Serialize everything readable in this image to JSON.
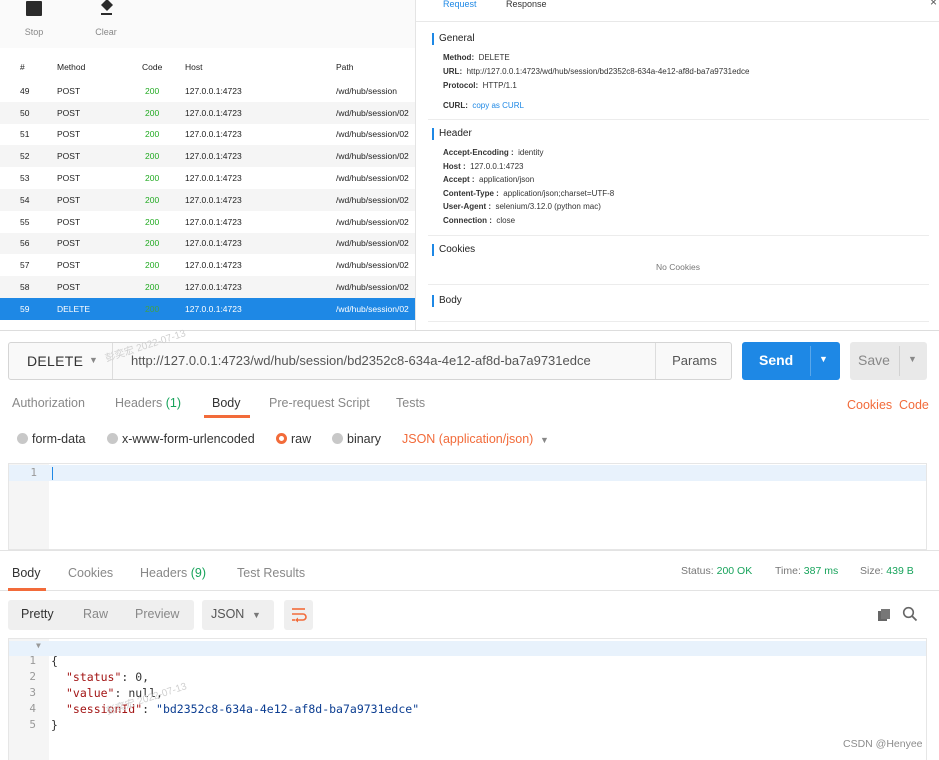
{
  "toolbar": {
    "stop_label": "Stop",
    "clear_label": "Clear"
  },
  "request_table": {
    "headers": {
      "num": "#",
      "method": "Method",
      "code": "Code",
      "host": "Host",
      "path": "Path"
    },
    "rows": [
      {
        "num": "49",
        "method": "POST",
        "code": "200",
        "host": "127.0.0.1:4723",
        "path": "/wd/hub/session"
      },
      {
        "num": "50",
        "method": "POST",
        "code": "200",
        "host": "127.0.0.1:4723",
        "path": "/wd/hub/session/02"
      },
      {
        "num": "51",
        "method": "POST",
        "code": "200",
        "host": "127.0.0.1:4723",
        "path": "/wd/hub/session/02"
      },
      {
        "num": "52",
        "method": "POST",
        "code": "200",
        "host": "127.0.0.1:4723",
        "path": "/wd/hub/session/02"
      },
      {
        "num": "53",
        "method": "POST",
        "code": "200",
        "host": "127.0.0.1:4723",
        "path": "/wd/hub/session/02"
      },
      {
        "num": "54",
        "method": "POST",
        "code": "200",
        "host": "127.0.0.1:4723",
        "path": "/wd/hub/session/02"
      },
      {
        "num": "55",
        "method": "POST",
        "code": "200",
        "host": "127.0.0.1:4723",
        "path": "/wd/hub/session/02"
      },
      {
        "num": "56",
        "method": "POST",
        "code": "200",
        "host": "127.0.0.1:4723",
        "path": "/wd/hub/session/02"
      },
      {
        "num": "57",
        "method": "POST",
        "code": "200",
        "host": "127.0.0.1:4723",
        "path": "/wd/hub/session/02"
      },
      {
        "num": "58",
        "method": "POST",
        "code": "200",
        "host": "127.0.0.1:4723",
        "path": "/wd/hub/session/02"
      },
      {
        "num": "59",
        "method": "DELETE",
        "code": "200",
        "host": "127.0.0.1:4723",
        "path": "/wd/hub/session/02",
        "selected": true
      }
    ]
  },
  "detail": {
    "tabs": {
      "request": "Request",
      "response": "Response"
    },
    "close": "×",
    "general": {
      "title": "General",
      "method_key": "Method:",
      "method_val": "DELETE",
      "url_key": "URL:",
      "url_val": "http://127.0.0.1:4723/wd/hub/session/bd2352c8-634a-4e12-af8d-ba7a9731edce",
      "protocol_key": "Protocol:",
      "protocol_val": "HTTP/1.1",
      "curl_key": "CURL:",
      "curl_val": "copy as CURL"
    },
    "header": {
      "title": "Header",
      "items": [
        {
          "key": "Accept-Encoding :",
          "val": "identity"
        },
        {
          "key": "Host :",
          "val": "127.0.0.1:4723"
        },
        {
          "key": "Accept :",
          "val": "application/json"
        },
        {
          "key": "Content-Type :",
          "val": "application/json;charset=UTF-8"
        },
        {
          "key": "User-Agent :",
          "val": "selenium/3.12.0 (python mac)"
        },
        {
          "key": "Connection :",
          "val": "close"
        }
      ]
    },
    "cookies": {
      "title": "Cookies",
      "empty": "No Cookies"
    },
    "body": {
      "title": "Body"
    }
  },
  "request": {
    "method": "DELETE",
    "url": "http://127.0.0.1:4723/wd/hub/session/bd2352c8-634a-4e12-af8d-ba7a9731edce",
    "params_label": "Params",
    "send_label": "Send",
    "save_label": "Save"
  },
  "request_tabs": {
    "authorization": "Authorization",
    "headers": "Headers",
    "headers_count": "(1)",
    "body": "Body",
    "prerequest": "Pre-request Script",
    "tests": "Tests",
    "cookies": "Cookies",
    "code": "Code"
  },
  "body_options": {
    "form_data": "form-data",
    "urlencoded": "x-www-form-urlencoded",
    "raw": "raw",
    "binary": "binary",
    "selected": "raw",
    "content_type": "JSON (application/json)"
  },
  "request_editor": {
    "line_numbers": [
      "1"
    ]
  },
  "response_tabs": {
    "body": "Body",
    "cookies": "Cookies",
    "headers": "Headers",
    "headers_count": "(9)",
    "test_results": "Test Results"
  },
  "response_stats": {
    "status_label": "Status:",
    "status_value": "200 OK",
    "time_label": "Time:",
    "time_value": "387 ms",
    "size_label": "Size:",
    "size_value": "439 B"
  },
  "response_view": {
    "pretty": "Pretty",
    "raw": "Raw",
    "preview": "Preview",
    "format": "JSON"
  },
  "response_body": {
    "lines": [
      {
        "n": "1",
        "text": "{"
      },
      {
        "n": "2",
        "key": "\"status\"",
        "rest": ": 0,"
      },
      {
        "n": "3",
        "key": "\"value\"",
        "rest": ": null,"
      },
      {
        "n": "4",
        "key": "\"sessionId\"",
        "rest": ": ",
        "str": "\"bd2352c8-634a-4e12-af8d-ba7a9731edce\""
      },
      {
        "n": "5",
        "text": "}"
      }
    ]
  },
  "watermark": {
    "text": "彭奕宏  2022-07-13"
  },
  "credit": "CSDN @Henyee",
  "colors": {
    "accent_blue": "#1e88e5",
    "accent_orange": "#f26b3a",
    "success_green": "#17a35b"
  }
}
